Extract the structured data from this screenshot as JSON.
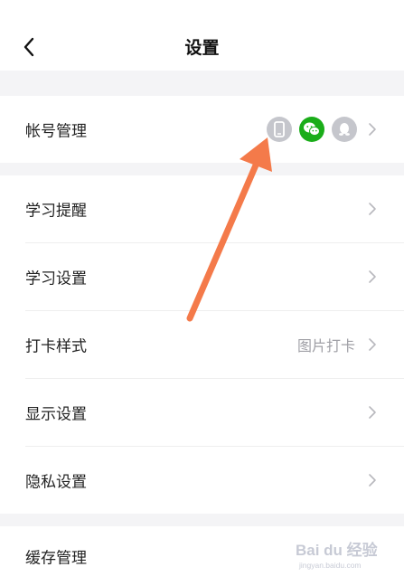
{
  "header": {
    "title": "设置"
  },
  "rows": [
    {
      "label": "帐号管理",
      "value": ""
    },
    {
      "label": "学习提醒",
      "value": ""
    },
    {
      "label": "学习设置",
      "value": ""
    },
    {
      "label": "打卡样式",
      "value": "图片打卡"
    },
    {
      "label": "显示设置",
      "value": ""
    },
    {
      "label": "隐私设置",
      "value": ""
    },
    {
      "label": "缓存管理",
      "value": ""
    }
  ],
  "account_icons": [
    {
      "icon": "phone-icon",
      "color": "#c5c6cc",
      "linked": false
    },
    {
      "icon": "wechat-icon",
      "color": "#1aad19",
      "linked": true
    },
    {
      "icon": "qq-icon",
      "color": "#c5c6cc",
      "linked": false
    }
  ],
  "annotation": {
    "arrow_color": "#f47a4a"
  },
  "watermark": {
    "text_line1": "Bai du 经验",
    "text_line2": "jingyan.baidu.com"
  },
  "colors": {
    "background": "#ffffff",
    "section_gap": "#f4f4f6",
    "text_primary": "#222222",
    "text_secondary": "#a0a0a6",
    "chevron": "#b8b8bd"
  }
}
